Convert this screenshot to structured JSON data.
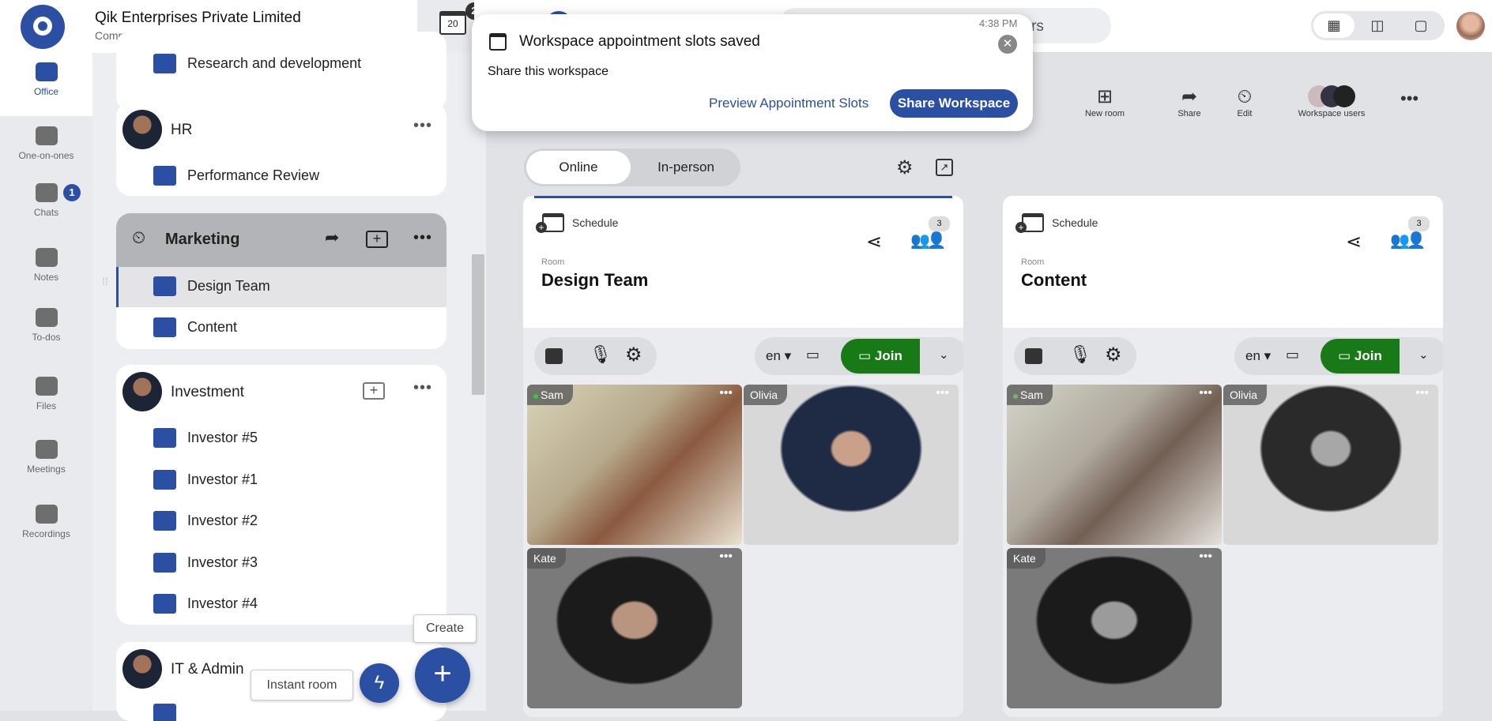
{
  "company": {
    "name": "Qik Enterprises Private Limited",
    "subtitle": "Company - Enterprise"
  },
  "calendar": {
    "day": "20",
    "badge": "2"
  },
  "rail": [
    {
      "label": "Office",
      "icon": "briefcase-icon",
      "active": true
    },
    {
      "label": "One-on-ones",
      "icon": "people-icon"
    },
    {
      "label": "Chats",
      "icon": "chat-icon",
      "badge": "1"
    },
    {
      "label": "Notes",
      "icon": "notes-icon"
    },
    {
      "label": "To-dos",
      "icon": "checkbox-icon"
    },
    {
      "label": "Files",
      "icon": "files-icon"
    },
    {
      "label": "Meetings",
      "icon": "meetings-icon"
    },
    {
      "label": "Recordings",
      "icon": "recording-icon"
    }
  ],
  "groups": {
    "rnd": {
      "items": [
        "Research and development"
      ]
    },
    "hr": {
      "name": "HR",
      "items": [
        "Performance Review"
      ]
    },
    "marketing": {
      "name": "Marketing",
      "items": [
        "Design Team",
        "Content"
      ],
      "selected": "Design Team"
    },
    "investment": {
      "name": "Investment",
      "items": [
        "Investor #5",
        "Investor #1",
        "Investor #2",
        "Investor #3",
        "Investor #4"
      ]
    },
    "it": {
      "name": "IT & Admin"
    }
  },
  "fab": {
    "create": "Create",
    "instant": "Instant room"
  },
  "search": {
    "visible_text": "sers"
  },
  "toolbar": {
    "new_room": "New room",
    "share": "Share",
    "edit": "Edit",
    "workspace_users": "Workspace users"
  },
  "tabs": {
    "online": "Online",
    "inperson": "In-person",
    "active": "Online"
  },
  "popup": {
    "time": "4:38 PM",
    "title": "Workspace appointment slots saved",
    "body": "Share this workspace",
    "preview": "Preview Appointment Slots",
    "share": "Share Workspace"
  },
  "rooms": [
    {
      "schedule": "Schedule",
      "label": "Room",
      "name": "Design Team",
      "count": "3",
      "lang": "en",
      "join": "Join",
      "participants": [
        "Sam",
        "Olivia",
        "Kate"
      ]
    },
    {
      "schedule": "Schedule",
      "label": "Room",
      "name": "Content",
      "count": "3",
      "lang": "en",
      "join": "Join",
      "participants": [
        "Sam",
        "Olivia",
        "Kate"
      ]
    }
  ],
  "colors": {
    "accent": "#2a4fa3",
    "join": "#177a17",
    "online_dot": "#2ecc40"
  }
}
